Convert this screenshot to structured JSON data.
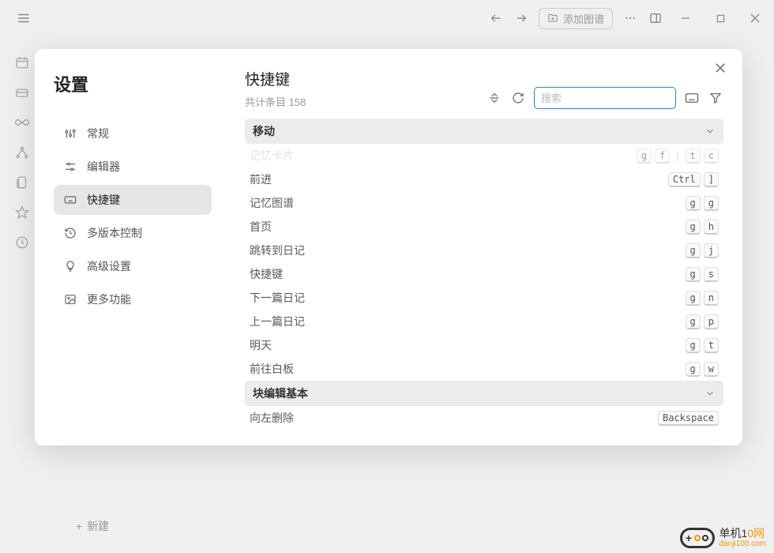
{
  "topbar": {
    "add_graph_label": "添加图谱"
  },
  "new_button_label": "新建",
  "modal": {
    "title": "设置",
    "nav": [
      {
        "label": "常规"
      },
      {
        "label": "编辑器"
      },
      {
        "label": "快捷键"
      },
      {
        "label": "多版本控制"
      },
      {
        "label": "高级设置"
      },
      {
        "label": "更多功能"
      }
    ],
    "panel_title": "快捷键",
    "count_prefix": "共计条目 ",
    "count": "158",
    "search_placeholder": "搜索",
    "sections": [
      {
        "title": "移动",
        "rows": [
          {
            "label": "记忆卡片",
            "keys": [
              "g",
              "f"
            ],
            "sep_keys": [
              "t",
              "c"
            ],
            "cut": true
          },
          {
            "label": "前进",
            "keys": [
              "Ctrl",
              "]"
            ]
          },
          {
            "label": "记忆图谱",
            "keys": [
              "g",
              "g"
            ]
          },
          {
            "label": "首页",
            "keys": [
              "g",
              "h"
            ]
          },
          {
            "label": "跳转到日记",
            "keys": [
              "g",
              "j"
            ]
          },
          {
            "label": "快捷键",
            "keys": [
              "g",
              "s"
            ]
          },
          {
            "label": "下一篇日记",
            "keys": [
              "g",
              "n"
            ]
          },
          {
            "label": "上一篇日记",
            "keys": [
              "g",
              "p"
            ]
          },
          {
            "label": "明天",
            "keys": [
              "g",
              "t"
            ]
          },
          {
            "label": "前往白板",
            "keys": [
              "g",
              "w"
            ]
          }
        ]
      },
      {
        "title": "块编辑基本",
        "rows": [
          {
            "label": "向左删除",
            "keys": [
              "Backspace"
            ]
          }
        ]
      }
    ]
  },
  "watermark": {
    "cn_pre": "单机1",
    "cn_mid": "0",
    "cn_suf": "网",
    "url": "danji100.com"
  }
}
